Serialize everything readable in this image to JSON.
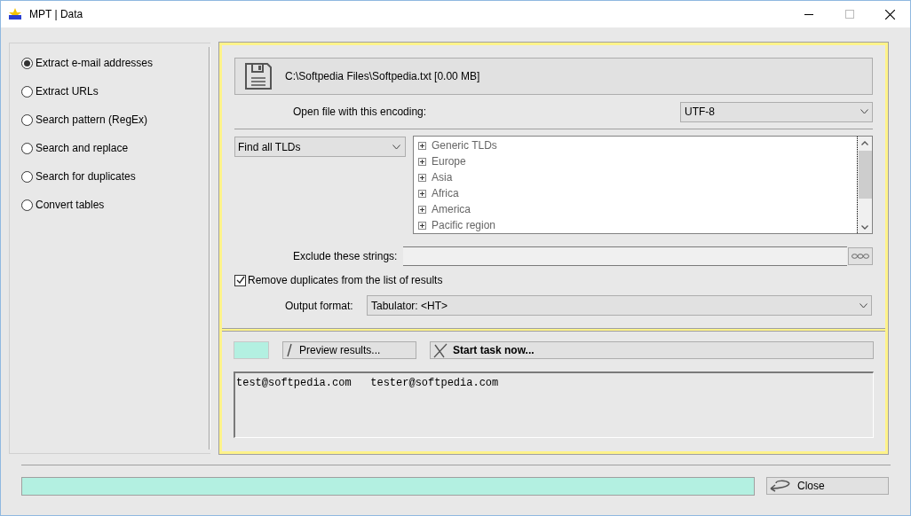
{
  "window": {
    "title": "MPT | Data"
  },
  "modes": [
    {
      "label": "Extract e-mail addresses",
      "selected": true
    },
    {
      "label": "Extract URLs",
      "selected": false
    },
    {
      "label": "Search pattern (RegEx)",
      "selected": false
    },
    {
      "label": "Search and replace",
      "selected": false
    },
    {
      "label": "Search for duplicates",
      "selected": false
    },
    {
      "label": "Convert tables",
      "selected": false
    }
  ],
  "file": {
    "path": "C:\\Softpedia Files\\Softpedia.txt [0.00 MB]"
  },
  "encoding": {
    "label": "Open file with this encoding:",
    "value": "UTF-8"
  },
  "tld_filter": {
    "value": "Find all TLDs"
  },
  "tld_tree": [
    {
      "label": "Generic TLDs",
      "expanded": false
    },
    {
      "label": "Europe",
      "expanded": false
    },
    {
      "label": "Asia",
      "expanded": false
    },
    {
      "label": "Africa",
      "expanded": false
    },
    {
      "label": "America",
      "expanded": false
    },
    {
      "label": "Pacific region",
      "expanded": false
    }
  ],
  "exclude": {
    "label": "Exclude these strings:"
  },
  "remove_duplicates": {
    "label": "Remove duplicates from the list of results",
    "checked": true
  },
  "output_format": {
    "label": "Output format:",
    "value": "Tabulator: <HT>"
  },
  "buttons": {
    "preview": "Preview results...",
    "start": "Start task now...",
    "close": "Close"
  },
  "results": "test@softpedia.com   tester@softpedia.com"
}
